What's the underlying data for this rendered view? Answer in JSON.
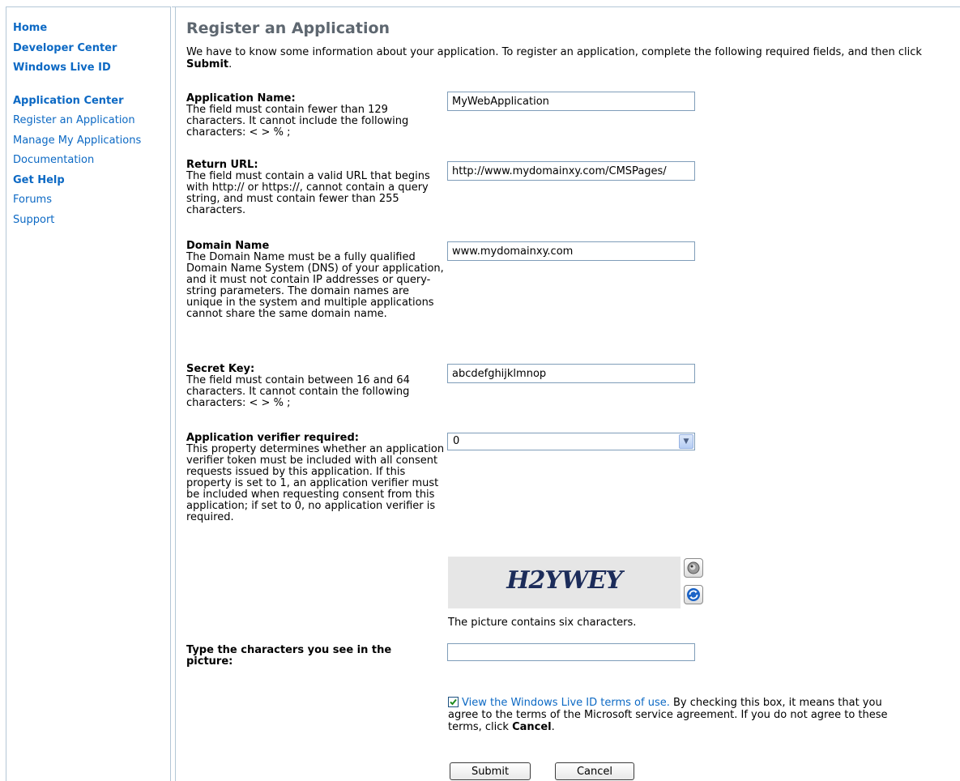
{
  "sidebar": {
    "top_links": [
      "Home",
      "Developer Center",
      "Windows Live ID"
    ],
    "items": [
      {
        "label": "Application Center",
        "bold": true
      },
      {
        "label": "Register an Application",
        "bold": false
      },
      {
        "label": "Manage My Applications",
        "bold": false
      },
      {
        "label": "Documentation",
        "bold": false
      },
      {
        "label": "Get Help",
        "bold": true
      },
      {
        "label": "Forums",
        "bold": false
      },
      {
        "label": "Support",
        "bold": false
      }
    ]
  },
  "page": {
    "title": "Register an Application",
    "intro_text": "We have to know some information about your application. To register an application, complete the following required fields, and then click ",
    "intro_bold": "Submit",
    "intro_end": "."
  },
  "fields": {
    "app_name": {
      "label": "Application Name:",
      "help": "The field must contain fewer than 129 characters. It cannot include the following characters: < > % ;",
      "value": "MyWebApplication"
    },
    "return_url": {
      "label": "Return URL:",
      "help": "The field must contain a valid URL that begins with http:// or https://, cannot contain a query string, and must contain fewer than 255 characters.",
      "value": "http://www.mydomainxy.com/CMSPages/"
    },
    "domain_name": {
      "label": "Domain Name",
      "help": "The Domain Name must be a fully qualified Domain Name System (DNS) of your application, and it must not contain IP addresses or query-string parameters. The domain names are unique in the system and multiple applications cannot share the same domain name.",
      "value": "www.mydomainxy.com"
    },
    "secret_key": {
      "label": "Secret Key:",
      "help": "The field must contain between 16 and 64 characters. It cannot contain the following characters: < > % ;",
      "value": "abcdefghijklmnop"
    },
    "verifier": {
      "label": "Application verifier required:",
      "help": "This property determines whether an application verifier token must be included with all consent requests issued by this application. If this property is set to 1, an application verifier must be included when requesting consent from this application; if set to 0, no application verifier is required.",
      "value": "0"
    }
  },
  "captcha": {
    "image_text": "H2YWEY",
    "note": "The picture contains six characters.",
    "label": "Type the characters you see in the picture:",
    "value": ""
  },
  "terms": {
    "checked": true,
    "link_text": "View the Windows Live ID terms of use.",
    "text": " By checking this box, it means that you agree to the terms of the Microsoft service agreement. If you do not agree to these terms, click ",
    "bold": "Cancel",
    "end": "."
  },
  "buttons": {
    "submit": "Submit",
    "cancel": "Cancel"
  },
  "icons": {
    "audio": "speaker-icon",
    "refresh": "refresh-icon",
    "dropdown": "chevron-down-icon",
    "check": "check-icon"
  },
  "colors": {
    "link": "#0c69c4",
    "heading": "#5e6770",
    "border": "#b4c7d6"
  }
}
